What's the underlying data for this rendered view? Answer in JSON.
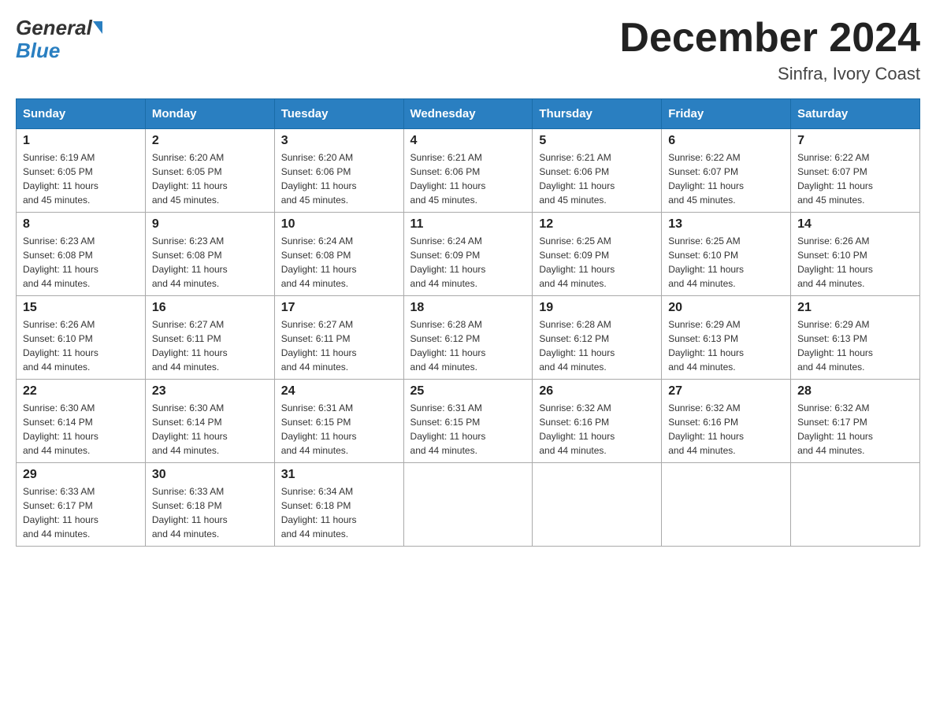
{
  "header": {
    "logo_general": "General",
    "logo_blue": "Blue",
    "month_title": "December 2024",
    "location": "Sinfra, Ivory Coast"
  },
  "calendar": {
    "headers": [
      "Sunday",
      "Monday",
      "Tuesday",
      "Wednesday",
      "Thursday",
      "Friday",
      "Saturday"
    ],
    "weeks": [
      [
        {
          "day": "1",
          "sunrise": "6:19 AM",
          "sunset": "6:05 PM",
          "daylight": "11 hours and 45 minutes."
        },
        {
          "day": "2",
          "sunrise": "6:20 AM",
          "sunset": "6:05 PM",
          "daylight": "11 hours and 45 minutes."
        },
        {
          "day": "3",
          "sunrise": "6:20 AM",
          "sunset": "6:06 PM",
          "daylight": "11 hours and 45 minutes."
        },
        {
          "day": "4",
          "sunrise": "6:21 AM",
          "sunset": "6:06 PM",
          "daylight": "11 hours and 45 minutes."
        },
        {
          "day": "5",
          "sunrise": "6:21 AM",
          "sunset": "6:06 PM",
          "daylight": "11 hours and 45 minutes."
        },
        {
          "day": "6",
          "sunrise": "6:22 AM",
          "sunset": "6:07 PM",
          "daylight": "11 hours and 45 minutes."
        },
        {
          "day": "7",
          "sunrise": "6:22 AM",
          "sunset": "6:07 PM",
          "daylight": "11 hours and 45 minutes."
        }
      ],
      [
        {
          "day": "8",
          "sunrise": "6:23 AM",
          "sunset": "6:08 PM",
          "daylight": "11 hours and 44 minutes."
        },
        {
          "day": "9",
          "sunrise": "6:23 AM",
          "sunset": "6:08 PM",
          "daylight": "11 hours and 44 minutes."
        },
        {
          "day": "10",
          "sunrise": "6:24 AM",
          "sunset": "6:08 PM",
          "daylight": "11 hours and 44 minutes."
        },
        {
          "day": "11",
          "sunrise": "6:24 AM",
          "sunset": "6:09 PM",
          "daylight": "11 hours and 44 minutes."
        },
        {
          "day": "12",
          "sunrise": "6:25 AM",
          "sunset": "6:09 PM",
          "daylight": "11 hours and 44 minutes."
        },
        {
          "day": "13",
          "sunrise": "6:25 AM",
          "sunset": "6:10 PM",
          "daylight": "11 hours and 44 minutes."
        },
        {
          "day": "14",
          "sunrise": "6:26 AM",
          "sunset": "6:10 PM",
          "daylight": "11 hours and 44 minutes."
        }
      ],
      [
        {
          "day": "15",
          "sunrise": "6:26 AM",
          "sunset": "6:10 PM",
          "daylight": "11 hours and 44 minutes."
        },
        {
          "day": "16",
          "sunrise": "6:27 AM",
          "sunset": "6:11 PM",
          "daylight": "11 hours and 44 minutes."
        },
        {
          "day": "17",
          "sunrise": "6:27 AM",
          "sunset": "6:11 PM",
          "daylight": "11 hours and 44 minutes."
        },
        {
          "day": "18",
          "sunrise": "6:28 AM",
          "sunset": "6:12 PM",
          "daylight": "11 hours and 44 minutes."
        },
        {
          "day": "19",
          "sunrise": "6:28 AM",
          "sunset": "6:12 PM",
          "daylight": "11 hours and 44 minutes."
        },
        {
          "day": "20",
          "sunrise": "6:29 AM",
          "sunset": "6:13 PM",
          "daylight": "11 hours and 44 minutes."
        },
        {
          "day": "21",
          "sunrise": "6:29 AM",
          "sunset": "6:13 PM",
          "daylight": "11 hours and 44 minutes."
        }
      ],
      [
        {
          "day": "22",
          "sunrise": "6:30 AM",
          "sunset": "6:14 PM",
          "daylight": "11 hours and 44 minutes."
        },
        {
          "day": "23",
          "sunrise": "6:30 AM",
          "sunset": "6:14 PM",
          "daylight": "11 hours and 44 minutes."
        },
        {
          "day": "24",
          "sunrise": "6:31 AM",
          "sunset": "6:15 PM",
          "daylight": "11 hours and 44 minutes."
        },
        {
          "day": "25",
          "sunrise": "6:31 AM",
          "sunset": "6:15 PM",
          "daylight": "11 hours and 44 minutes."
        },
        {
          "day": "26",
          "sunrise": "6:32 AM",
          "sunset": "6:16 PM",
          "daylight": "11 hours and 44 minutes."
        },
        {
          "day": "27",
          "sunrise": "6:32 AM",
          "sunset": "6:16 PM",
          "daylight": "11 hours and 44 minutes."
        },
        {
          "day": "28",
          "sunrise": "6:32 AM",
          "sunset": "6:17 PM",
          "daylight": "11 hours and 44 minutes."
        }
      ],
      [
        {
          "day": "29",
          "sunrise": "6:33 AM",
          "sunset": "6:17 PM",
          "daylight": "11 hours and 44 minutes."
        },
        {
          "day": "30",
          "sunrise": "6:33 AM",
          "sunset": "6:18 PM",
          "daylight": "11 hours and 44 minutes."
        },
        {
          "day": "31",
          "sunrise": "6:34 AM",
          "sunset": "6:18 PM",
          "daylight": "11 hours and 44 minutes."
        },
        null,
        null,
        null,
        null
      ]
    ],
    "labels": {
      "sunrise": "Sunrise:",
      "sunset": "Sunset:",
      "daylight": "Daylight:"
    }
  }
}
